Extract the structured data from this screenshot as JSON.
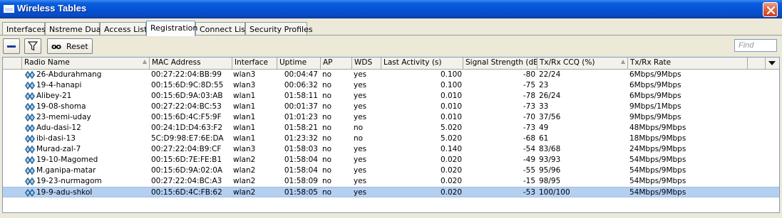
{
  "window": {
    "title": "Wireless Tables",
    "close_icon": "close-icon"
  },
  "tabs": [
    {
      "label": "Interfaces",
      "active": false
    },
    {
      "label": "Nstreme Dual",
      "active": false
    },
    {
      "label": "Access List",
      "active": false
    },
    {
      "label": "Registration",
      "active": true
    },
    {
      "label": "Connect List",
      "active": false
    },
    {
      "label": "Security Profiles",
      "active": false
    }
  ],
  "toolbar": {
    "remove_icon": "minus-icon",
    "filter_icon": "filter-icon",
    "reset_icon": "oo",
    "reset_label": "Reset",
    "find_placeholder": "Find"
  },
  "table": {
    "columns": [
      "Radio Name",
      "MAC Address",
      "Interface",
      "Uptime",
      "AP",
      "WDS",
      "Last Activity (s)",
      "Signal Strength (dB...",
      "Tx/Rx CCQ (%)",
      "Tx/Rx Rate"
    ],
    "rows": [
      {
        "radio_name": "26-Abdurahmang",
        "mac": "00:27:22:04:BB:99",
        "interface": "wlan3",
        "uptime": "00:04:47",
        "ap": "no",
        "wds": "yes",
        "last_activity": "0.100",
        "signal": "-80",
        "ccq": "22/24",
        "rate": "6Mbps/9Mbps",
        "selected": false
      },
      {
        "radio_name": "19-4-hanapi",
        "mac": "00:15:6D:9C:8D:55",
        "interface": "wlan3",
        "uptime": "00:06:32",
        "ap": "no",
        "wds": "yes",
        "last_activity": "0.100",
        "signal": "-75",
        "ccq": "23",
        "rate": "6Mbps/9Mbps",
        "selected": false
      },
      {
        "radio_name": "Alibey-21",
        "mac": "00:15:6D:9A:03:AB",
        "interface": "wlan1",
        "uptime": "01:58:11",
        "ap": "no",
        "wds": "yes",
        "last_activity": "0.010",
        "signal": "-78",
        "ccq": "26/24",
        "rate": "6Mbps/9Mbps",
        "selected": false
      },
      {
        "radio_name": "19-08-shoma",
        "mac": "00:27:22:04:BC:53",
        "interface": "wlan1",
        "uptime": "00:01:37",
        "ap": "no",
        "wds": "yes",
        "last_activity": "0.010",
        "signal": "-73",
        "ccq": "33",
        "rate": "9Mbps/1Mbps",
        "selected": false
      },
      {
        "radio_name": "23-memi-uday",
        "mac": "00:15:6D:4C:F5:9F",
        "interface": "wlan1",
        "uptime": "01:01:23",
        "ap": "no",
        "wds": "yes",
        "last_activity": "0.010",
        "signal": "-70",
        "ccq": "37/56",
        "rate": "9Mbps/9Mbps",
        "selected": false
      },
      {
        "radio_name": "Adu-dasi-12",
        "mac": "00:24:1D:D4:63:F2",
        "interface": "wlan1",
        "uptime": "01:58:21",
        "ap": "no",
        "wds": "no",
        "last_activity": "5.020",
        "signal": "-73",
        "ccq": "49",
        "rate": "48Mbps/9Mbps",
        "selected": false
      },
      {
        "radio_name": "ibi-dasi-13",
        "mac": "5C:D9:98:E7:6E:DA",
        "interface": "wlan1",
        "uptime": "01:23:32",
        "ap": "no",
        "wds": "no",
        "last_activity": "5.020",
        "signal": "-68",
        "ccq": "61",
        "rate": "18Mbps/9Mbps",
        "selected": false
      },
      {
        "radio_name": "Murad-zal-7",
        "mac": "00:27:22:04:B9:CF",
        "interface": "wlan3",
        "uptime": "01:58:03",
        "ap": "no",
        "wds": "yes",
        "last_activity": "0.140",
        "signal": "-54",
        "ccq": "83/68",
        "rate": "24Mbps/9Mbps",
        "selected": false
      },
      {
        "radio_name": "19-10-Magomed",
        "mac": "00:15:6D:7E:FE:B1",
        "interface": "wlan2",
        "uptime": "01:58:04",
        "ap": "no",
        "wds": "yes",
        "last_activity": "0.020",
        "signal": "-49",
        "ccq": "93/93",
        "rate": "54Mbps/9Mbps",
        "selected": false
      },
      {
        "radio_name": "M.ganipa-matar",
        "mac": "00:15:6D:9A:02:0A",
        "interface": "wlan2",
        "uptime": "01:58:04",
        "ap": "no",
        "wds": "yes",
        "last_activity": "0.020",
        "signal": "-55",
        "ccq": "95/96",
        "rate": "54Mbps/9Mbps",
        "selected": false
      },
      {
        "radio_name": "19-23-nurmagom",
        "mac": "00:27:22:04:BC:A3",
        "interface": "wlan2",
        "uptime": "01:58:09",
        "ap": "no",
        "wds": "yes",
        "last_activity": "0.020",
        "signal": "-15",
        "ccq": "98/95",
        "rate": "54Mbps/9Mbps",
        "selected": false
      },
      {
        "radio_name": "19-9-adu-shkol",
        "mac": "00:15:6D:4C:FB:62",
        "interface": "wlan2",
        "uptime": "01:58:05",
        "ap": "no",
        "wds": "yes",
        "last_activity": "0.020",
        "signal": "-53",
        "ccq": "100/100",
        "rate": "54Mbps/9Mbps",
        "selected": true
      }
    ]
  },
  "colors": {
    "titlebar": "#0553d8",
    "selected_row": "#b4cff0",
    "window_bg": "#ece9d8"
  }
}
